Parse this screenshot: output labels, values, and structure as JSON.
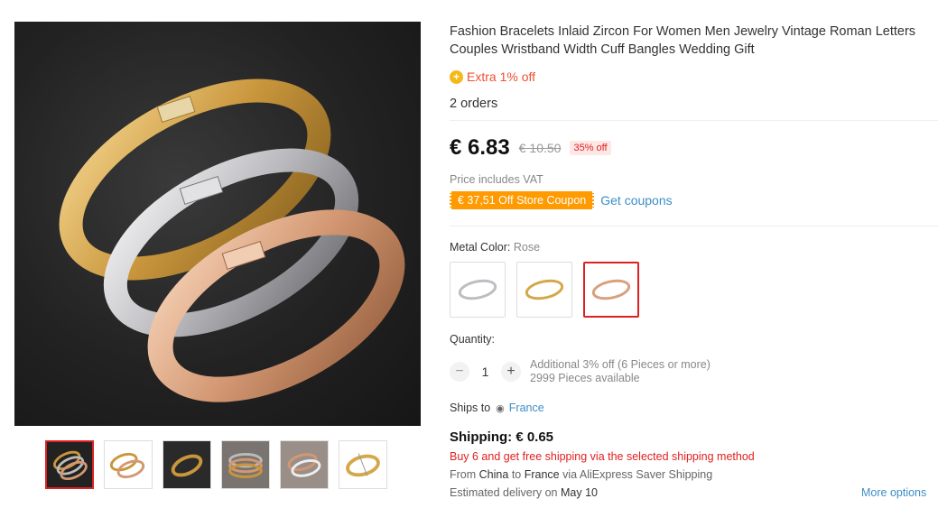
{
  "product": {
    "title": "Fashion Bracelets Inlaid Zircon For Women Men Jewelry Vintage Roman Letters Couples Wristband Width Cuff Bangles Wedding Gift",
    "extra_discount": "Extra 1% off",
    "orders": "2 orders"
  },
  "price": {
    "current": "€ 6.83",
    "original": "€ 10.50",
    "discount": "35% off",
    "vat_note": "Price includes VAT",
    "coupon": "€ 37,51 Off Store Coupon",
    "get_coupons": "Get coupons"
  },
  "options": {
    "metal_label": "Metal Color:",
    "metal_value": "Rose",
    "swatches": [
      "Silver",
      "Gold",
      "Rose"
    ],
    "selected": "Rose"
  },
  "quantity": {
    "label": "Quantity:",
    "minus": "−",
    "value": "1",
    "plus": "+",
    "additional": "Additional 3% off (6 Pieces or more)",
    "available": "2999 Pieces available"
  },
  "shipping": {
    "ships_to_label": "Ships to",
    "country": "France",
    "cost": "Shipping: € 0.65",
    "free_note": "Buy 6 and get free shipping via the selected shipping method",
    "route_from": "From",
    "route_origin": "China",
    "route_to": "to",
    "route_dest": "France",
    "route_via": "via AliExpress Saver Shipping",
    "delivery_label": "Estimated delivery on",
    "delivery_date": "May 10",
    "more_options": "More options"
  },
  "icons": {
    "coin": "coin-icon",
    "pin": "location-pin-icon"
  },
  "colors": {
    "accent_red": "#e02020",
    "link_blue": "#3c8ec6",
    "coupon_orange": "#ff9a00",
    "gold": "#d4a84a",
    "silver": "#c8c8cc",
    "rose": "#d9a07e"
  }
}
